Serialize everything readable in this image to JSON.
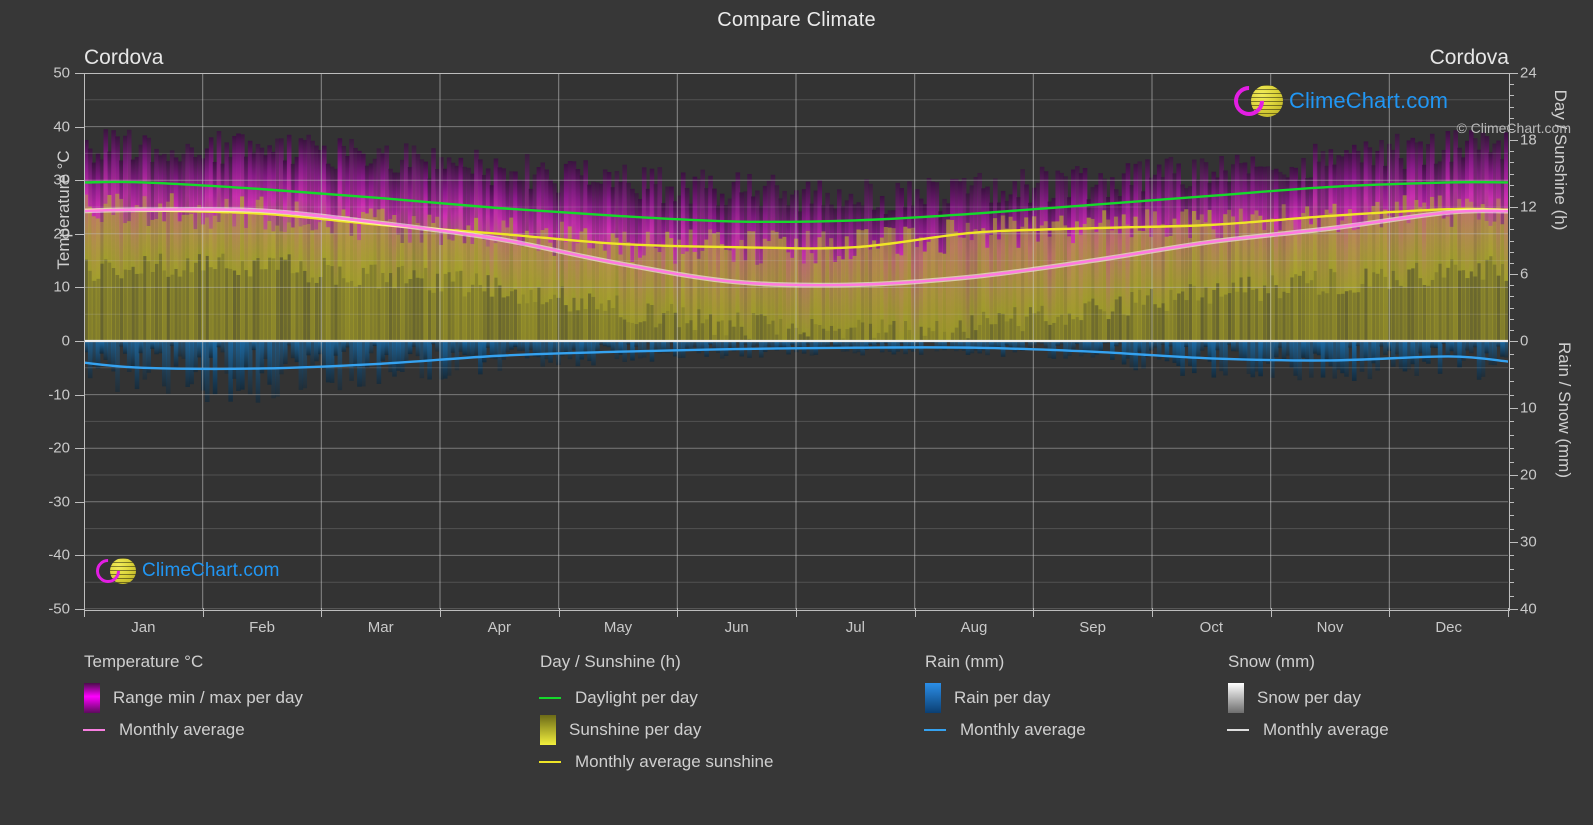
{
  "header": {
    "title": "Compare Climate",
    "location_left": "Cordova",
    "location_right": "Cordova"
  },
  "watermark": {
    "text": "ClimeChart.com",
    "brand_blue": "#2196f3",
    "brand_magenta": "#e31ee3",
    "brand_yellow": "#ddd53c"
  },
  "footer": {
    "copyright": "© ClimeChart.com"
  },
  "axes": {
    "left_title": "Temperature °C",
    "left_ticks": [
      "50",
      "40",
      "30",
      "20",
      "10",
      "0",
      "-10",
      "-20",
      "-30",
      "-40",
      "-50"
    ],
    "right_title_top": "Day / Sunshine (h)",
    "right_ticks_top": [
      "24",
      "18",
      "12",
      "6",
      "0"
    ],
    "right_title_bottom": "Rain / Snow (mm)",
    "right_ticks_bottom": [
      "0",
      "10",
      "20",
      "30",
      "40"
    ],
    "x_labels": [
      "Jan",
      "Feb",
      "Mar",
      "Apr",
      "May",
      "Jun",
      "Jul",
      "Aug",
      "Sep",
      "Oct",
      "Nov",
      "Dec"
    ]
  },
  "legend": {
    "columns": [
      {
        "title": "Temperature °C",
        "items": [
          {
            "label": "Range min / max per day",
            "type": "gradient",
            "color": "#e31ee3",
            "name": "temp-range-swatch"
          },
          {
            "label": "Monthly average",
            "type": "line",
            "color": "#f77fe0",
            "name": "temp-average-line-swatch"
          }
        ]
      },
      {
        "title": "Day / Sunshine (h)",
        "items": [
          {
            "label": "Daylight per day",
            "type": "line",
            "color": "#15d92b",
            "name": "daylight-line-swatch"
          },
          {
            "label": "Sunshine per day",
            "type": "gradient",
            "color": "#e8e62e",
            "name": "sunshine-swatch"
          },
          {
            "label": "Monthly average sunshine",
            "type": "line",
            "color": "#efe527",
            "name": "sunshine-average-line-swatch"
          }
        ]
      },
      {
        "title": "Rain (mm)",
        "items": [
          {
            "label": "Rain per day",
            "type": "gradient",
            "color": "#1a84de",
            "name": "rain-swatch"
          },
          {
            "label": "Monthly average",
            "type": "line",
            "color": "#35a2f0",
            "name": "rain-average-line-swatch"
          }
        ]
      },
      {
        "title": "Snow (mm)",
        "items": [
          {
            "label": "Snow per day",
            "type": "gradient",
            "color": "#ffffff",
            "name": "snow-swatch"
          },
          {
            "label": "Monthly average",
            "type": "line",
            "color": "#dedede",
            "name": "snow-average-line-swatch"
          }
        ]
      }
    ]
  },
  "chart_data": {
    "type": "line",
    "title": "Compare Climate",
    "xlabel": "",
    "ylabel": "Temperature °C",
    "ylim": [
      -50,
      50
    ],
    "grid": true,
    "legend_position": "below",
    "categories": [
      "Jan",
      "Feb",
      "Mar",
      "Apr",
      "May",
      "Jun",
      "Jul",
      "Aug",
      "Sep",
      "Oct",
      "Nov",
      "Dec"
    ],
    "right_axis_top": {
      "label": "Day / Sunshine (h)",
      "range": [
        0,
        24
      ]
    },
    "right_axis_bottom": {
      "label": "Rain / Snow (mm)",
      "range": [
        0,
        40
      ]
    },
    "series": [
      {
        "name": "Monthly average temperature",
        "unit": "°C",
        "color": "#f77fe0",
        "axis": "left",
        "values": [
          24.5,
          24.3,
          22.0,
          19.0,
          14.5,
          11.0,
          10.5,
          12.0,
          15.0,
          18.5,
          21.0,
          24.0
        ]
      },
      {
        "name": "Range max per day (band top)",
        "unit": "°C",
        "color": "#c220c2",
        "axis": "left",
        "values": [
          36,
          36,
          34,
          32,
          30,
          28,
          27,
          28,
          30,
          32,
          34,
          36
        ]
      },
      {
        "name": "Range min per day (band bottom)",
        "unit": "°C",
        "color": "#c220c2",
        "axis": "left",
        "values": [
          14,
          14,
          12,
          10,
          6,
          3,
          2,
          3,
          6,
          9,
          11,
          13
        ]
      },
      {
        "name": "Daylight per day",
        "unit": "h",
        "color": "#15d92b",
        "axis": "right-top",
        "values": [
          14.2,
          13.6,
          12.8,
          11.9,
          11.2,
          10.7,
          10.8,
          11.4,
          12.2,
          13.0,
          13.8,
          14.2
        ]
      },
      {
        "name": "Monthly average sunshine",
        "unit": "h",
        "color": "#efe527",
        "axis": "right-top",
        "values": [
          11.7,
          11.4,
          10.4,
          9.6,
          8.7,
          8.4,
          8.4,
          9.7,
          10.1,
          10.4,
          11.2,
          11.8
        ]
      },
      {
        "name": "Rain monthly average",
        "unit": "mm",
        "color": "#35a2f0",
        "axis": "right-bottom",
        "values": [
          4.0,
          4.1,
          3.4,
          2.2,
          1.6,
          1.2,
          1.0,
          1.0,
          1.6,
          2.6,
          2.9,
          2.3
        ]
      },
      {
        "name": "Snow monthly average",
        "unit": "mm",
        "color": "#dedede",
        "axis": "right-bottom",
        "values": [
          0,
          0,
          0,
          0,
          0,
          0,
          0,
          0,
          0,
          0,
          0,
          0
        ]
      }
    ]
  }
}
